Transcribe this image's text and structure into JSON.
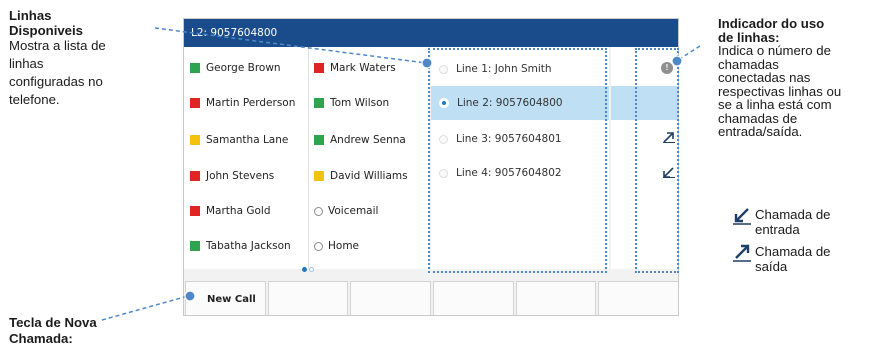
{
  "screen": {
    "title": "L2: 9057604800",
    "contacts_left": [
      {
        "name": "George Brown",
        "color": "#2ea44f",
        "marker": "square"
      },
      {
        "name": "Martin Perderson",
        "color": "#e02424",
        "marker": "square"
      },
      {
        "name": "Samantha Lane",
        "color": "#f4c20d",
        "marker": "square"
      },
      {
        "name": "John Stevens",
        "color": "#e02424",
        "marker": "square"
      },
      {
        "name": "Martha Gold",
        "color": "#e02424",
        "marker": "square"
      },
      {
        "name": "Tabatha Jackson",
        "color": "#2ea44f",
        "marker": "square"
      }
    ],
    "contacts_right": [
      {
        "name": "Mark Waters",
        "color": "#e02424",
        "marker": "square"
      },
      {
        "name": "Tom Wilson",
        "color": "#2ea44f",
        "marker": "square"
      },
      {
        "name": "Andrew Senna",
        "color": "#2ea44f",
        "marker": "square"
      },
      {
        "name": "David Williams",
        "color": "#f4c20d",
        "marker": "square"
      },
      {
        "name": "Voicemail",
        "color": "#ffffff",
        "marker": "circle"
      },
      {
        "name": "Home",
        "color": "#ffffff",
        "marker": "circle"
      }
    ],
    "lines": [
      {
        "label": "Line 1: John Smith",
        "selected": false
      },
      {
        "label": "Line 2: 9057604800",
        "selected": true
      },
      {
        "label": "Line 3: 9057604801",
        "selected": false
      },
      {
        "label": "Line 4: 9057604802",
        "selected": false
      }
    ],
    "indicator_badge": "!",
    "softkeys": [
      "New Call",
      "",
      "",
      "",
      "",
      ""
    ],
    "page_indicator": {
      "count": 2,
      "active": 1
    }
  },
  "annotations": {
    "lines_available": {
      "title_line1": "Linhas",
      "title_line2": "Disponiveis",
      "body": [
        "Mostra a lista de",
        "linhas",
        "configuradas no",
        "telefone."
      ]
    },
    "usage_indicator": {
      "title_line1": "Indicador do uso",
      "title_line2": "de linhas:",
      "body": [
        "Indica o número de",
        "chamadas",
        "conectadas nas",
        "respectivas linhas ou",
        "se a linha está com",
        "chamadas de",
        "entrada/saída."
      ]
    },
    "incoming_call": {
      "line1": "Chamada de",
      "line2": "entrada",
      "icon": "incoming-arrow-icon"
    },
    "outgoing_call": {
      "line1": "Chamada de",
      "line2": "saída",
      "icon": "outgoing-arrow-icon"
    },
    "new_call_key": {
      "line1": "Tecla de Nova",
      "line2": "Chamada:"
    }
  },
  "colors": {
    "titlebar": "#1a4c8b",
    "selection": "#bfe0f4",
    "leader": "#4e88c8",
    "arrow": "#1f3f66"
  }
}
